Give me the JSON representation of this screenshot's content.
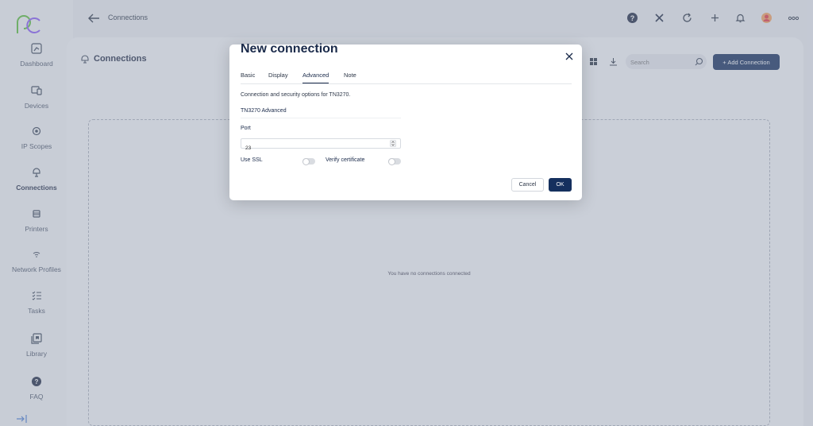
{
  "colors": {
    "primary": "#15305e",
    "logo_green": "#5bbf3a",
    "logo_purple": "#8b5cf6"
  },
  "sidebar": {
    "items": [
      {
        "label": "Dashboard",
        "icon": "dashboard-icon"
      },
      {
        "label": "Devices",
        "icon": "devices-icon"
      },
      {
        "label": "IP Scopes",
        "icon": "ip-scopes-icon"
      },
      {
        "label": "Connections",
        "icon": "connections-icon",
        "active": true
      },
      {
        "label": "Printers",
        "icon": "printer-icon"
      },
      {
        "label": "Network Profiles",
        "icon": "wifi-icon"
      },
      {
        "label": "Tasks",
        "icon": "tasks-icon"
      },
      {
        "label": "Library",
        "icon": "library-icon"
      },
      {
        "label": "FAQ",
        "icon": "faq-icon"
      }
    ]
  },
  "topbar": {
    "title": "Connections"
  },
  "main": {
    "title": "Connections",
    "search_placeholder": "Search",
    "add_button": "+ Add Connection",
    "empty_text": "You have no connections connected"
  },
  "modal": {
    "title": "New connection",
    "tabs": [
      "Basic",
      "Display",
      "Advanced",
      "Note"
    ],
    "active_tab": "Advanced",
    "description": "Connection and security options for TN3270.",
    "section_title": "TN3270 Advanced",
    "port_label": "Port",
    "port_value": "23",
    "use_ssl_label": "Use SSL",
    "verify_cert_label": "Verify certificate",
    "cancel_button": "Cancel",
    "ok_button": "OK"
  }
}
